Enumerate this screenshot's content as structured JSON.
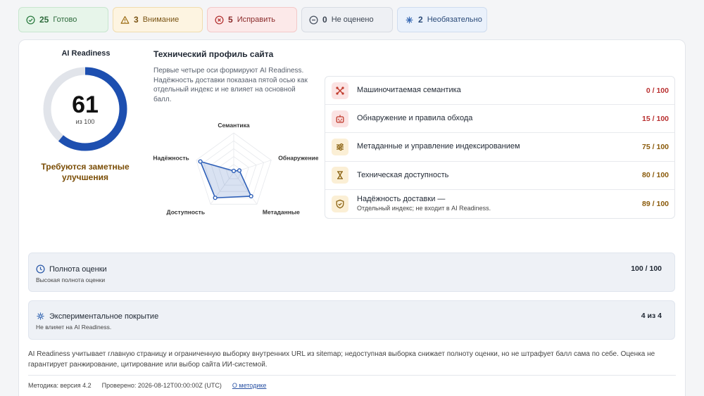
{
  "chips": [
    {
      "count": "25",
      "label": "Готово",
      "icon": "check-circle-icon"
    },
    {
      "count": "3",
      "label": "Внимание",
      "icon": "warning-triangle-icon"
    },
    {
      "count": "5",
      "label": "Исправить",
      "icon": "x-circle-icon"
    },
    {
      "count": "0",
      "label": "Не оценено",
      "icon": "minus-circle-icon"
    },
    {
      "count": "2",
      "label": "Необязательно",
      "icon": "asterisk-icon"
    }
  ],
  "readiness": {
    "title": "AI Readiness",
    "score": "61",
    "score_value": 61,
    "max_label": "из 100",
    "verdict": "Требуются заметные улучшения",
    "colors": {
      "ring": "#1d4fb0",
      "track": "#e1e4ea",
      "verdict": "#7a4d06"
    }
  },
  "profile": {
    "title": "Технический профиль сайта",
    "description": "Первые четыре оси формируют AI Readiness. Надёжность доставки показана пятой осью как отдельный индекс и не влияет на основной балл.",
    "radar_labels": [
      "Семантика",
      "Обнаружение",
      "Метаданные",
      "Доступность",
      "Надёжность"
    ],
    "radar_values": [
      0,
      15,
      75,
      80,
      89
    ],
    "radar_color": "#2d5fb8"
  },
  "axes": [
    {
      "name": "Машиночитаемая семантика",
      "note": "",
      "score": "0 / 100",
      "icon": "nodes-icon",
      "tone": "red"
    },
    {
      "name": "Обнаружение и правила обхода",
      "note": "",
      "score": "15 / 100",
      "icon": "robot-icon",
      "tone": "red"
    },
    {
      "name": "Метаданные и управление индексированием",
      "note": "",
      "score": "75 / 100",
      "icon": "sliders-icon",
      "tone": "amber"
    },
    {
      "name": "Техническая доступность",
      "note": "",
      "score": "80 / 100",
      "icon": "hourglass-icon",
      "tone": "amber"
    },
    {
      "name": "Надёжность доставки —",
      "note": "Отдельный индекс; не входит в AI Readiness.",
      "score": "89 / 100",
      "icon": "shield-check-icon",
      "tone": "amber"
    }
  ],
  "completeness": {
    "title": "Полнота оценки",
    "subtitle": "Высокая полнота оценки",
    "value": "100 / 100"
  },
  "experimental": {
    "title": "Экспериментальное покрытие",
    "subtitle": "Не влияет на AI Readiness.",
    "value": "4 из 4"
  },
  "note": "AI Readiness учитывает главную страницу и ограниченную выборку внутренних URL из sitemap; недоступная выборка снижает полноту оценки, но не штрафует балл сама по себе. Оценка не гарантирует ранжирование, цитирование или выбор сайта ИИ-системой.",
  "footer": {
    "method": "Методика: версия 4.2",
    "checked": "Проверено: 2026-08-12T00:00:00Z (UTC)",
    "link": "О методике"
  }
}
